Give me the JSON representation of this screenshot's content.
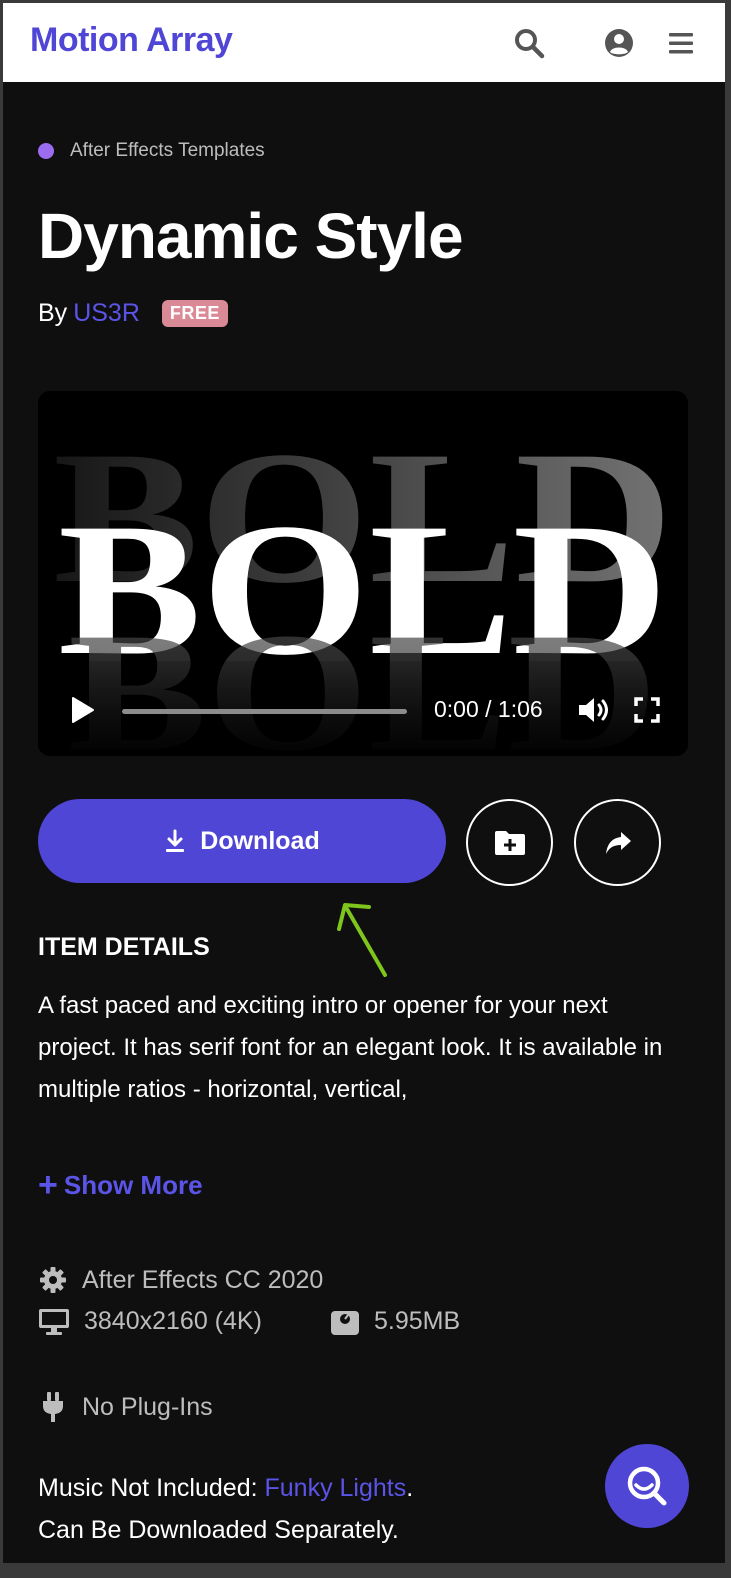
{
  "header": {
    "logo": "Motion Array",
    "icons": [
      "search-icon",
      "user-icon",
      "menu-icon"
    ]
  },
  "item": {
    "category": "After Effects Templates",
    "title": "Dynamic Style",
    "by_label": "By",
    "author": "US3R",
    "badge": "FREE"
  },
  "video": {
    "time": "0:00 / 1:06",
    "progress": 0,
    "preview_text": "BOLD"
  },
  "actions": {
    "download_label": "Download",
    "icons": [
      "download-icon",
      "add-folder-icon",
      "share-icon"
    ]
  },
  "details": {
    "heading": "ITEM DETAILS",
    "description": "A fast paced and exciting intro or opener for your next project. It has serif font for an elegant look. It is available in multiple ratios - horizontal, vertical,",
    "show_more": "Show More"
  },
  "specs": {
    "version": "After Effects CC 2020",
    "resolution": "3840x2160 (4K)",
    "size": "5.95MB",
    "plugins": "No Plug-Ins"
  },
  "music": {
    "label": "Music Not Included:",
    "link": "Funky Lights",
    "after_link": ".",
    "line2": "Can Be Downloaded Separately."
  },
  "colors": {
    "brand": "#5046d6",
    "link": "#5b54e8",
    "badge": "#d98a96",
    "category_dot": "#9b6cf0",
    "annotation_arrow": "#7ec51c"
  }
}
